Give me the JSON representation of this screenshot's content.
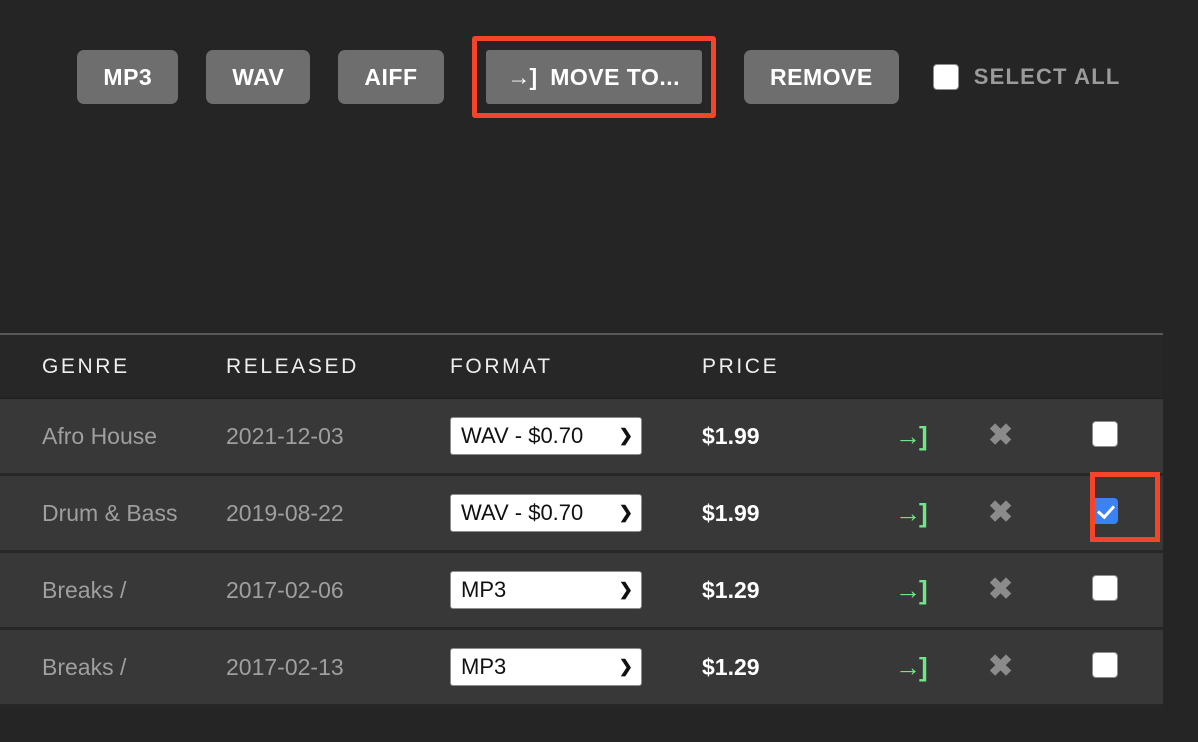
{
  "toolbar": {
    "format_buttons": [
      {
        "label": "MP3",
        "name": "mp3-button"
      },
      {
        "label": "WAV",
        "name": "wav-button"
      },
      {
        "label": "AIFF",
        "name": "aiff-button"
      }
    ],
    "move_to": {
      "label": "MOVE TO...",
      "icon": "move-to-icon",
      "icon_glyph": "→]",
      "highlighted": true,
      "highlight_color": "#f4452a"
    },
    "remove": {
      "label": "REMOVE"
    },
    "select_all": {
      "label": "SELECT ALL",
      "checked": false
    },
    "button_color": "#6e6e6e",
    "button_text_color": "#ffffff"
  },
  "table": {
    "headers": [
      "GENRE",
      "RELEASED",
      "FORMAT",
      "PRICE"
    ],
    "icons": {
      "move_glyph": "→]",
      "remove_glyph": "✖",
      "move_color": "#6ee787",
      "remove_color": "#8b8b8b"
    },
    "rows": [
      {
        "genre": "Afro House",
        "released": "2021-12-03",
        "format": "WAV - $0.70",
        "price": "$1.99",
        "checked": false,
        "checkbox_highlighted": false
      },
      {
        "genre": "Drum & Bass",
        "released": "2019-08-22",
        "format": "WAV - $0.70",
        "price": "$1.99",
        "checked": true,
        "checkbox_highlighted": true
      },
      {
        "genre": "Breaks /",
        "released": "2017-02-06",
        "format": "MP3",
        "price": "$1.29",
        "checked": false,
        "checkbox_highlighted": false
      },
      {
        "genre": "Breaks /",
        "released": "2017-02-13",
        "format": "MP3",
        "price": "$1.29",
        "checked": false,
        "checkbox_highlighted": false
      }
    ],
    "chevron_glyph": "⌄"
  },
  "colors": {
    "page_background": "#252525",
    "row_background": "#383838",
    "header_background": "#272727",
    "accent_highlight": "#f4452a",
    "checked_checkbox": "#3b82f6"
  }
}
